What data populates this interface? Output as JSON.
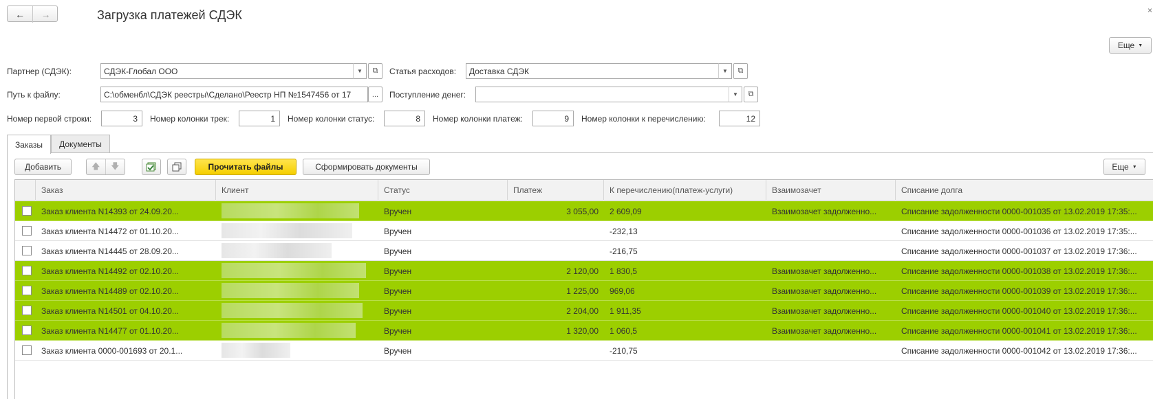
{
  "window": {
    "title": "Загрузка платежей СДЭК",
    "top_more_label": "Еще",
    "close_glyph": "×"
  },
  "form": {
    "partner": {
      "label": "Партнер (СДЭК):",
      "value": "СДЭК-Глобал ООО"
    },
    "expense": {
      "label": "Статья расходов:",
      "value": "Доставка СДЭК"
    },
    "filepath": {
      "label": "Путь к файлу:",
      "value": "C:\\обменбл\\СДЭК реестры\\Сделано\\Реестр НП №1547456 от 17",
      "browse": "..."
    },
    "income": {
      "label": "Поступление денег:",
      "value": ""
    },
    "first_row": {
      "label": "Номер первой строки:",
      "value": "3"
    },
    "track_col": {
      "label": "Номер колонки трек:",
      "value": "1"
    },
    "status_col": {
      "label": "Номер колонки статус:",
      "value": "8"
    },
    "payment_col": {
      "label": "Номер колонки платеж:",
      "value": "9"
    },
    "transfer_col": {
      "label": "Номер колонки к перечислению:",
      "value": "12"
    }
  },
  "tabs": [
    {
      "label": "Заказы"
    },
    {
      "label": "Документы"
    }
  ],
  "toolbar": {
    "add_label": "Добавить",
    "read_files_label": "Прочитать файлы",
    "make_docs_label": "Сформировать документы",
    "more_label": "Еще"
  },
  "table": {
    "headers": [
      "Заказ",
      "Клиент",
      "Статус",
      "Платеж",
      "К перечислению(платеж-услуги)",
      "Взаимозачет",
      "Списание долга"
    ],
    "rows": [
      {
        "order": "Заказ клиента N14393 от 24.09.20...",
        "status": "Вручен",
        "payment": "3 055,00",
        "transfer": "2 609,09",
        "offset": "Взаимозачет задолженно...",
        "writeoff": "Списание задолженности 0000-001035 от 13.02.2019 17:35:...",
        "highlight": true
      },
      {
        "order": "Заказ клиента N14472 от 01.10.20...",
        "status": "Вручен",
        "payment": "",
        "transfer": "-232,13",
        "offset": "",
        "writeoff": "Списание задолженности 0000-001036 от 13.02.2019 17:35:...",
        "highlight": false
      },
      {
        "order": "Заказ клиента N14445 от 28.09.20...",
        "status": "Вручен",
        "payment": "",
        "transfer": "-216,75",
        "offset": "",
        "writeoff": "Списание задолженности 0000-001037 от 13.02.2019 17:36:...",
        "highlight": false
      },
      {
        "order": "Заказ клиента N14492 от 02.10.20...",
        "status": "Вручен",
        "payment": "2 120,00",
        "transfer": "1 830,5",
        "offset": "Взаимозачет задолженно...",
        "writeoff": "Списание задолженности 0000-001038 от 13.02.2019 17:36:...",
        "highlight": true
      },
      {
        "order": "Заказ клиента N14489 от 02.10.20...",
        "status": "Вручен",
        "payment": "1 225,00",
        "transfer": "969,06",
        "offset": "Взаимозачет задолженно...",
        "writeoff": "Списание задолженности 0000-001039 от 13.02.2019 17:36:...",
        "highlight": true
      },
      {
        "order": "Заказ клиента N14501 от 04.10.20...",
        "status": "Вручен",
        "payment": "2 204,00",
        "transfer": "1 911,35",
        "offset": "Взаимозачет задолженно...",
        "writeoff": "Списание задолженности 0000-001040 от 13.02.2019 17:36:...",
        "highlight": true
      },
      {
        "order": "Заказ клиента N14477 от 01.10.20...",
        "status": "Вручен",
        "payment": "1 320,00",
        "transfer": "1 060,5",
        "offset": "Взаимозачет задолженно...",
        "writeoff": "Списание задолженности 0000-001041 от 13.02.2019 17:36:...",
        "highlight": true
      },
      {
        "order": "Заказ клиента 0000-001693 от 20.1...",
        "status": "Вручен",
        "payment": "",
        "transfer": "-210,75",
        "offset": "",
        "writeoff": "Списание задолженности 0000-001042 от 13.02.2019 17:36:...",
        "highlight": false
      }
    ]
  },
  "icons": {
    "back": "back-arrow-icon",
    "forward": "forward-arrow-icon",
    "move_up": "arrow-up-icon",
    "move_down": "arrow-down-icon",
    "check_all": "check-all-icon",
    "copy": "copy-icon",
    "dropdown": "chevron-down-icon",
    "open": "open-form-icon"
  },
  "colors": {
    "row_highlight": "#9ccf00",
    "primary_button": "#f5cf00"
  }
}
